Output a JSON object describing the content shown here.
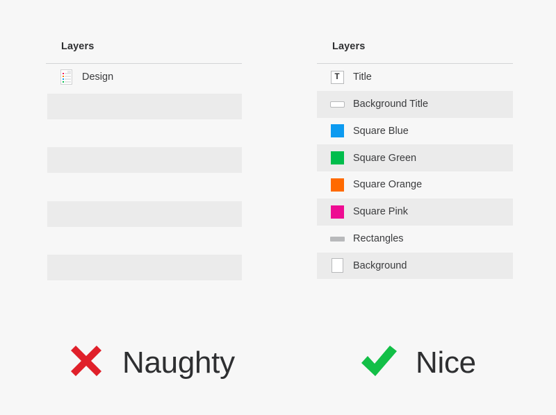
{
  "page": {
    "background_color": "#f7f7f7",
    "text_color": "#3a3b3d"
  },
  "left_panel": {
    "title": "Layers",
    "layers": [
      {
        "label": "Design",
        "icon": "sketch-document-icon"
      }
    ],
    "placeholder_bars": 4,
    "placeholder_color": "#ebebeb"
  },
  "right_panel": {
    "title": "Layers",
    "layers": [
      {
        "label": "Title",
        "icon": "text-layer-icon",
        "icon_glyph": "T",
        "striped": false
      },
      {
        "label": "Background Title",
        "icon": "rounded-rect-icon",
        "color": "#ffffff",
        "striped": true
      },
      {
        "label": "Square Blue",
        "icon": "color-swatch-icon",
        "color": "#0c9af0",
        "striped": false
      },
      {
        "label": "Square Green",
        "icon": "color-swatch-icon",
        "color": "#00bd4c",
        "striped": true
      },
      {
        "label": "Square Orange",
        "icon": "color-swatch-icon",
        "color": "#ff6a00",
        "striped": false
      },
      {
        "label": "Square Pink",
        "icon": "color-swatch-icon",
        "color": "#ee0c92",
        "striped": true
      },
      {
        "label": "Rectangles",
        "icon": "gray-bar-icon",
        "color": "#b8b9bb",
        "striped": false
      },
      {
        "label": "Background",
        "icon": "white-rect-icon",
        "color": "#ffffff",
        "striped": true
      }
    ]
  },
  "verdicts": {
    "naughty": {
      "label": "Naughty",
      "icon": "cross-icon",
      "color": "#e0202a"
    },
    "nice": {
      "label": "Nice",
      "icon": "check-icon",
      "color": "#13bf47"
    }
  }
}
